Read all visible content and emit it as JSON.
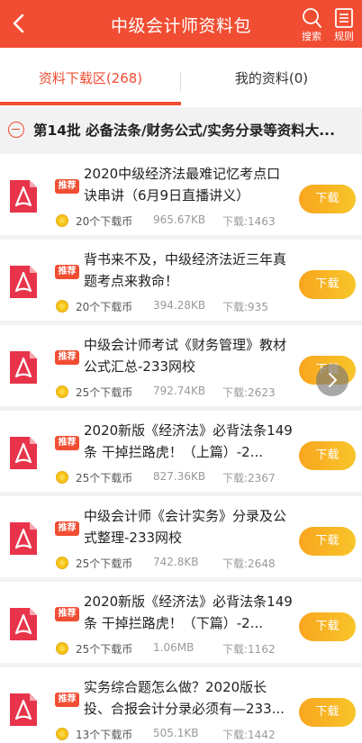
{
  "header": {
    "title": "中级会计师资料包",
    "search_label": "搜索",
    "rules_label": "规则"
  },
  "tabs": [
    {
      "label": "资料下载区(268)",
      "active": true
    },
    {
      "label": "我的资料(0)",
      "active": false
    }
  ],
  "section": {
    "title": "第14批 必备法条/财务公式/实务分录等资料大..."
  },
  "badge_label": "推荐",
  "download_label": "下载",
  "items": [
    {
      "title": "2020中级经济法最难记忆考点口诀串讲（6月9日直播讲义）",
      "price": "20个下载币",
      "size": "965.67KB",
      "downloads": "下载:1463"
    },
    {
      "title": "背书来不及，中级经济法近三年真题考点来救命！",
      "price": "20个下载币",
      "size": "394.28KB",
      "downloads": "下载:935"
    },
    {
      "title": "中级会计师考试《财务管理》教材公式汇总-233网校",
      "price": "25个下载币",
      "size": "792.74KB",
      "downloads": "下载:2623"
    },
    {
      "title": "2020新版《经济法》必背法条149条 干掉拦路虎！（上篇）-2...",
      "price": "25个下载币",
      "size": "827.36KB",
      "downloads": "下载:2367"
    },
    {
      "title": "中级会计师《会计实务》分录及公式整理-233网校",
      "price": "25个下载币",
      "size": "742.8KB",
      "downloads": "下载:2648"
    },
    {
      "title": "2020新版《经济法》必背法条149条 干掉拦路虎！（下篇）-2...",
      "price": "25个下载币",
      "size": "1.06MB",
      "downloads": "下载:1162"
    },
    {
      "title": "实务综合题怎么做？2020版长投、合报会计分录必须有—233...",
      "price": "13个下载币",
      "size": "505.1KB",
      "downloads": "下载:1442"
    }
  ],
  "colors": {
    "brand": "#f14d32",
    "download_button": "#f9a51e",
    "coin": "#f5c518"
  }
}
